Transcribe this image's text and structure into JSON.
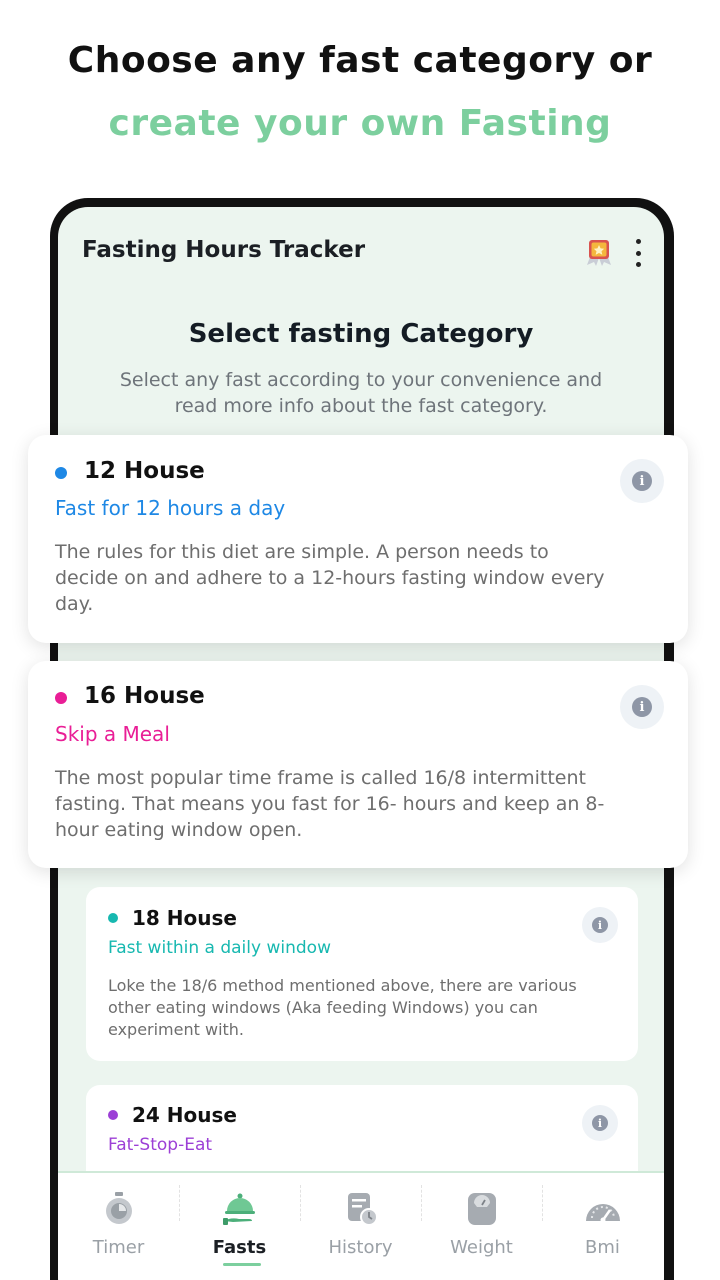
{
  "promo": {
    "line1": "Choose any fast category or",
    "line2": "create your own Fasting"
  },
  "appbar": {
    "title": "Fasting Hours Tracker",
    "icons": [
      "award-icon",
      "more-vert-icon"
    ]
  },
  "header": {
    "title": "Select fasting Category",
    "subtitle": "Select any fast according to your convenience and read more info about the fast category."
  },
  "categories": [
    {
      "title": "12 House",
      "subtitle": "Fast for 12 hours a day",
      "description": "The rules for this diet are simple. A person needs to decide on and adhere to a 12-hours fasting window every day.",
      "color": "#1e88e5"
    },
    {
      "title": "16 House",
      "subtitle": "Skip a Meal",
      "description": "The most popular time frame is called 16/8 intermittent fasting. That means you fast for 16- hours and keep an 8-hour eating window open.",
      "color": "#e91e96"
    },
    {
      "title": "18 House",
      "subtitle": "Fast within a daily window",
      "description": "Loke the 18/6 method mentioned above, there are various other eating windows (Aka feeding Windows) you can experiment with.",
      "color": "#17b8b0"
    },
    {
      "title": "24 House",
      "subtitle": "Fat-Stop-Eat",
      "description": "",
      "color": "#9c3fd6"
    }
  ],
  "nav": {
    "items": [
      {
        "label": "Timer",
        "icon": "stopwatch-icon"
      },
      {
        "label": "Fasts",
        "icon": "serving-dish-icon"
      },
      {
        "label": "History",
        "icon": "history-icon"
      },
      {
        "label": "Weight",
        "icon": "scale-icon"
      },
      {
        "label": "Bmi",
        "icon": "gauge-icon"
      }
    ],
    "active": "Fasts"
  },
  "colors": {
    "accent": "#7ccf9e",
    "screen_bg": "#ecf5ef",
    "info_icon": "#8e96a6"
  }
}
